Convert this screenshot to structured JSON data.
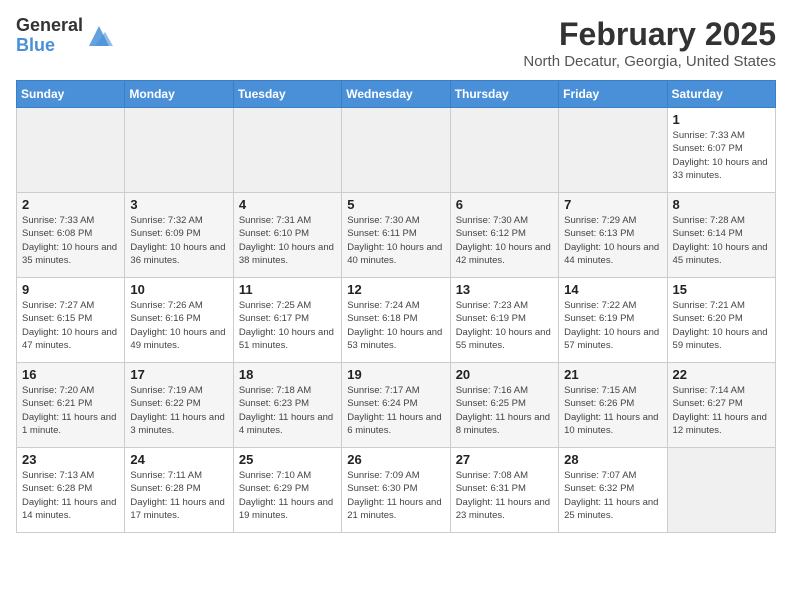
{
  "header": {
    "logo_general": "General",
    "logo_blue": "Blue",
    "month_year": "February 2025",
    "location": "North Decatur, Georgia, United States"
  },
  "weekdays": [
    "Sunday",
    "Monday",
    "Tuesday",
    "Wednesday",
    "Thursday",
    "Friday",
    "Saturday"
  ],
  "weeks": [
    [
      {
        "day": "",
        "empty": true
      },
      {
        "day": "",
        "empty": true
      },
      {
        "day": "",
        "empty": true
      },
      {
        "day": "",
        "empty": true
      },
      {
        "day": "",
        "empty": true
      },
      {
        "day": "",
        "empty": true
      },
      {
        "day": "1",
        "sunrise": "Sunrise: 7:33 AM",
        "sunset": "Sunset: 6:07 PM",
        "daylight": "Daylight: 10 hours and 33 minutes."
      }
    ],
    [
      {
        "day": "2",
        "sunrise": "Sunrise: 7:33 AM",
        "sunset": "Sunset: 6:08 PM",
        "daylight": "Daylight: 10 hours and 35 minutes."
      },
      {
        "day": "3",
        "sunrise": "Sunrise: 7:32 AM",
        "sunset": "Sunset: 6:09 PM",
        "daylight": "Daylight: 10 hours and 36 minutes."
      },
      {
        "day": "4",
        "sunrise": "Sunrise: 7:31 AM",
        "sunset": "Sunset: 6:10 PM",
        "daylight": "Daylight: 10 hours and 38 minutes."
      },
      {
        "day": "5",
        "sunrise": "Sunrise: 7:30 AM",
        "sunset": "Sunset: 6:11 PM",
        "daylight": "Daylight: 10 hours and 40 minutes."
      },
      {
        "day": "6",
        "sunrise": "Sunrise: 7:30 AM",
        "sunset": "Sunset: 6:12 PM",
        "daylight": "Daylight: 10 hours and 42 minutes."
      },
      {
        "day": "7",
        "sunrise": "Sunrise: 7:29 AM",
        "sunset": "Sunset: 6:13 PM",
        "daylight": "Daylight: 10 hours and 44 minutes."
      },
      {
        "day": "8",
        "sunrise": "Sunrise: 7:28 AM",
        "sunset": "Sunset: 6:14 PM",
        "daylight": "Daylight: 10 hours and 45 minutes."
      }
    ],
    [
      {
        "day": "9",
        "sunrise": "Sunrise: 7:27 AM",
        "sunset": "Sunset: 6:15 PM",
        "daylight": "Daylight: 10 hours and 47 minutes."
      },
      {
        "day": "10",
        "sunrise": "Sunrise: 7:26 AM",
        "sunset": "Sunset: 6:16 PM",
        "daylight": "Daylight: 10 hours and 49 minutes."
      },
      {
        "day": "11",
        "sunrise": "Sunrise: 7:25 AM",
        "sunset": "Sunset: 6:17 PM",
        "daylight": "Daylight: 10 hours and 51 minutes."
      },
      {
        "day": "12",
        "sunrise": "Sunrise: 7:24 AM",
        "sunset": "Sunset: 6:18 PM",
        "daylight": "Daylight: 10 hours and 53 minutes."
      },
      {
        "day": "13",
        "sunrise": "Sunrise: 7:23 AM",
        "sunset": "Sunset: 6:19 PM",
        "daylight": "Daylight: 10 hours and 55 minutes."
      },
      {
        "day": "14",
        "sunrise": "Sunrise: 7:22 AM",
        "sunset": "Sunset: 6:19 PM",
        "daylight": "Daylight: 10 hours and 57 minutes."
      },
      {
        "day": "15",
        "sunrise": "Sunrise: 7:21 AM",
        "sunset": "Sunset: 6:20 PM",
        "daylight": "Daylight: 10 hours and 59 minutes."
      }
    ],
    [
      {
        "day": "16",
        "sunrise": "Sunrise: 7:20 AM",
        "sunset": "Sunset: 6:21 PM",
        "daylight": "Daylight: 11 hours and 1 minute."
      },
      {
        "day": "17",
        "sunrise": "Sunrise: 7:19 AM",
        "sunset": "Sunset: 6:22 PM",
        "daylight": "Daylight: 11 hours and 3 minutes."
      },
      {
        "day": "18",
        "sunrise": "Sunrise: 7:18 AM",
        "sunset": "Sunset: 6:23 PM",
        "daylight": "Daylight: 11 hours and 4 minutes."
      },
      {
        "day": "19",
        "sunrise": "Sunrise: 7:17 AM",
        "sunset": "Sunset: 6:24 PM",
        "daylight": "Daylight: 11 hours and 6 minutes."
      },
      {
        "day": "20",
        "sunrise": "Sunrise: 7:16 AM",
        "sunset": "Sunset: 6:25 PM",
        "daylight": "Daylight: 11 hours and 8 minutes."
      },
      {
        "day": "21",
        "sunrise": "Sunrise: 7:15 AM",
        "sunset": "Sunset: 6:26 PM",
        "daylight": "Daylight: 11 hours and 10 minutes."
      },
      {
        "day": "22",
        "sunrise": "Sunrise: 7:14 AM",
        "sunset": "Sunset: 6:27 PM",
        "daylight": "Daylight: 11 hours and 12 minutes."
      }
    ],
    [
      {
        "day": "23",
        "sunrise": "Sunrise: 7:13 AM",
        "sunset": "Sunset: 6:28 PM",
        "daylight": "Daylight: 11 hours and 14 minutes."
      },
      {
        "day": "24",
        "sunrise": "Sunrise: 7:11 AM",
        "sunset": "Sunset: 6:28 PM",
        "daylight": "Daylight: 11 hours and 17 minutes."
      },
      {
        "day": "25",
        "sunrise": "Sunrise: 7:10 AM",
        "sunset": "Sunset: 6:29 PM",
        "daylight": "Daylight: 11 hours and 19 minutes."
      },
      {
        "day": "26",
        "sunrise": "Sunrise: 7:09 AM",
        "sunset": "Sunset: 6:30 PM",
        "daylight": "Daylight: 11 hours and 21 minutes."
      },
      {
        "day": "27",
        "sunrise": "Sunrise: 7:08 AM",
        "sunset": "Sunset: 6:31 PM",
        "daylight": "Daylight: 11 hours and 23 minutes."
      },
      {
        "day": "28",
        "sunrise": "Sunrise: 7:07 AM",
        "sunset": "Sunset: 6:32 PM",
        "daylight": "Daylight: 11 hours and 25 minutes."
      },
      {
        "day": "",
        "empty": true
      }
    ]
  ]
}
